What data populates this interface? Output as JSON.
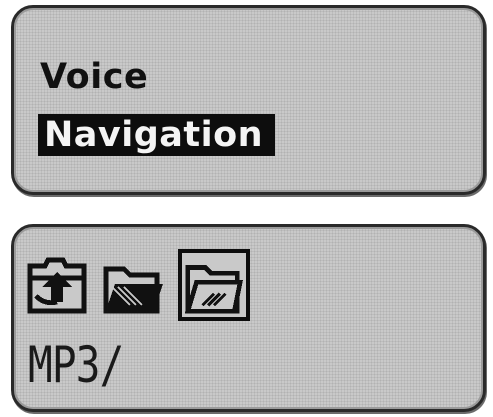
{
  "menu": {
    "items": [
      {
        "label": "Voice",
        "selected": false
      },
      {
        "label": "Navigation",
        "selected": true
      }
    ]
  },
  "browser": {
    "icons": [
      {
        "name": "folder-up-icon",
        "selected": false
      },
      {
        "name": "folder-icon",
        "selected": false
      },
      {
        "name": "folder-open-icon",
        "selected": true
      }
    ],
    "path": "MP3/"
  },
  "colors": {
    "lcd_background": "#c9c9c9",
    "pixel_on": "#111111",
    "bezel": "#2a2a2a"
  }
}
